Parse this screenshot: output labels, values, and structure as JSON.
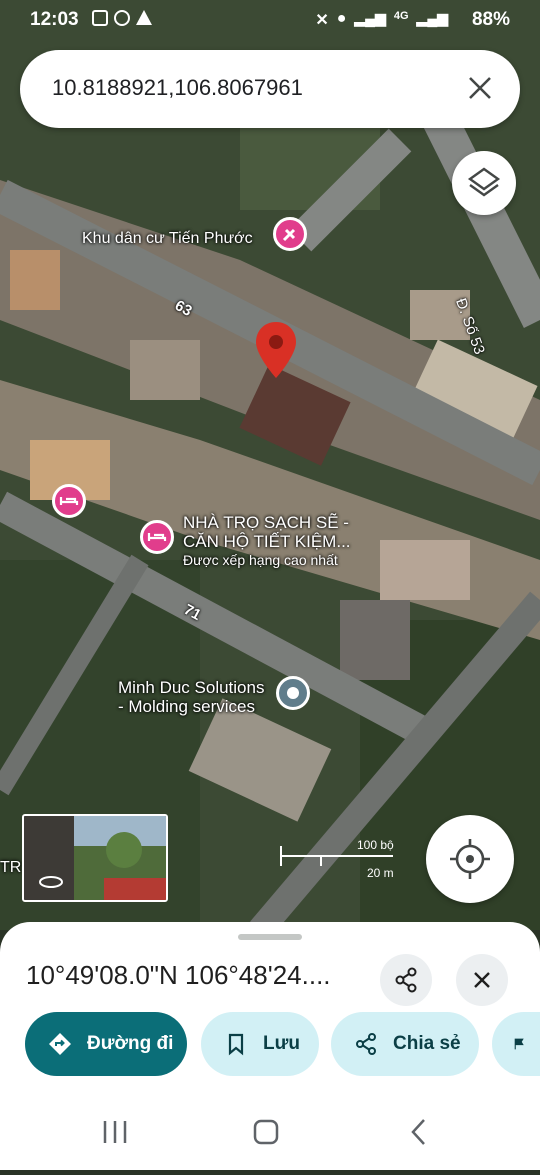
{
  "status_bar": {
    "time": "12:03",
    "battery": "88%",
    "network": "4G"
  },
  "search": {
    "query": "10.8188921,106.8067961"
  },
  "map": {
    "labels": {
      "residential_area": "Khu dân cư Tiến Phước",
      "road_63": "63",
      "road_71": "71",
      "road_so53": "Đ. Số 53",
      "guesthouse_line1": "NHÀ TRỌ SẠCH SẼ -",
      "guesthouse_line2": "CĂN HỘ TIẾT KIỆM...",
      "guesthouse_sub": "Được xếp hạng cao nhất",
      "business_line1": "Minh Duc Solutions",
      "business_line2": "- Molding services",
      "edge_label": "TR"
    },
    "scale": {
      "top": "100 bộ",
      "bottom": "20 m"
    }
  },
  "colors": {
    "accent": "#0b6e78",
    "chip_bg": "#d2f0f5",
    "pin": "#d93025",
    "poi": "#e13d8c"
  },
  "bottom_sheet": {
    "coordinates": "10°49'08.0\"N 106°48'24....",
    "actions": {
      "directions": "Đường đi",
      "save": "Lưu",
      "share": "Chia sẻ"
    }
  }
}
